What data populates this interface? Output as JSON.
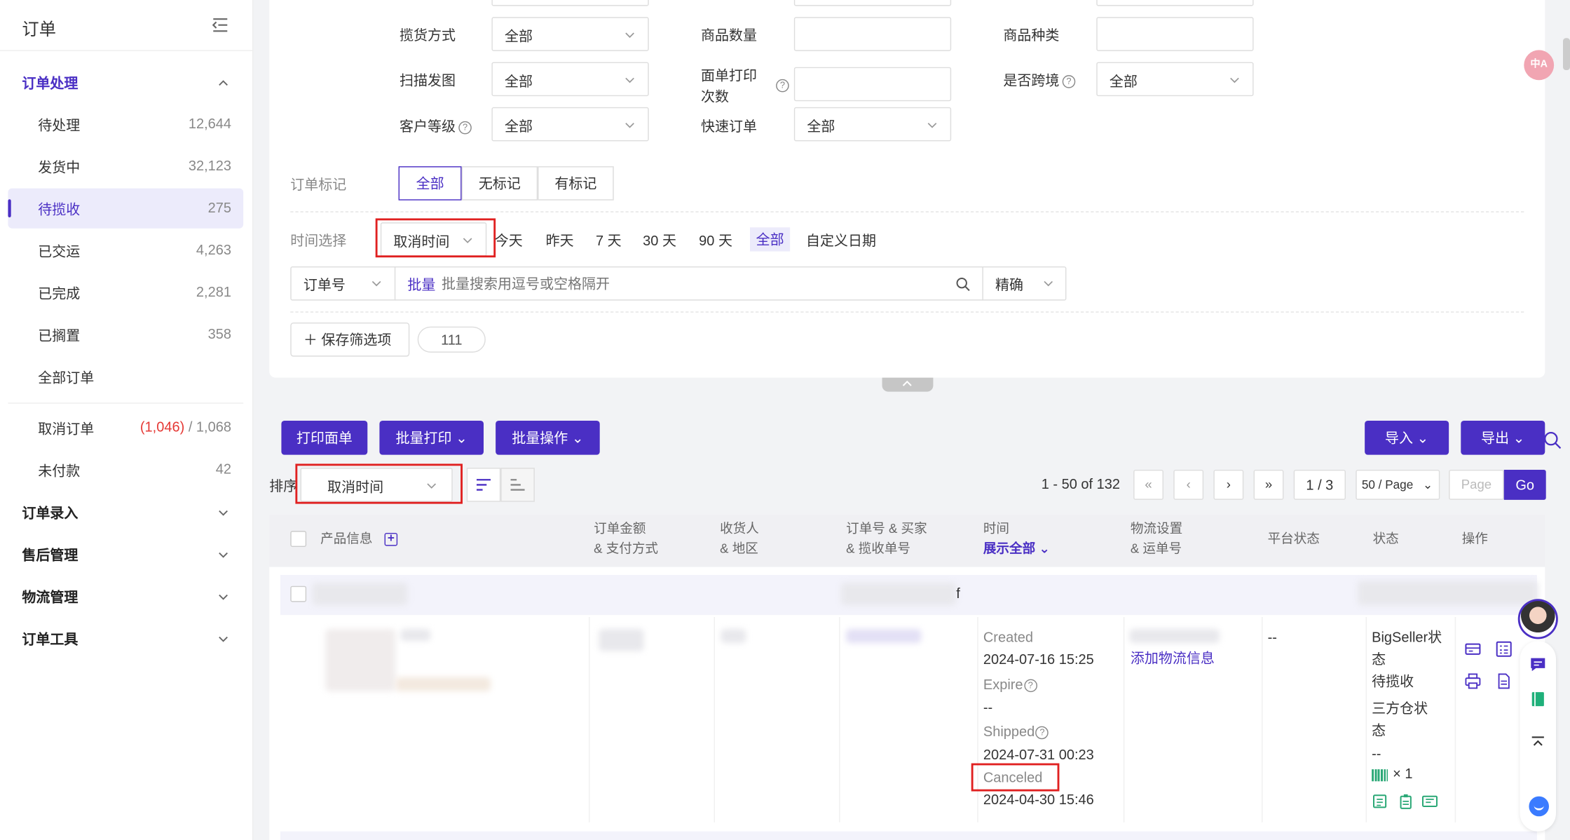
{
  "sidebar": {
    "title": "订单",
    "groups": {
      "processing": "订单处理",
      "entry": "订单录入",
      "aftersale": "售后管理",
      "logistics": "物流管理",
      "tools": "订单工具"
    },
    "items": [
      {
        "label": "待处理",
        "count": "12,644"
      },
      {
        "label": "发货中",
        "count": "32,123"
      },
      {
        "label": "待揽收",
        "count": "275"
      },
      {
        "label": "已交运",
        "count": "4,263"
      },
      {
        "label": "已完成",
        "count": "2,281"
      },
      {
        "label": "已搁置",
        "count": "358"
      },
      {
        "label": "全部订单",
        "count": ""
      }
    ],
    "cancel": {
      "label": "取消订单",
      "count_red": "(1,046)",
      "count_total": "/ 1,068"
    },
    "unpaid": {
      "label": "未付款",
      "count": "42"
    }
  },
  "filters": {
    "pickup_method": {
      "label": "揽货方式",
      "value": "全部"
    },
    "item_qty": {
      "label": "商品数量",
      "value": ""
    },
    "item_kinds": {
      "label": "商品种类",
      "value": ""
    },
    "scan_image": {
      "label": "扫描发图",
      "value": "全部"
    },
    "print_count": {
      "label1": "面单打印",
      "label2": "次数",
      "value": ""
    },
    "cross_border": {
      "label": "是否跨境",
      "value": "全部"
    },
    "customer_level": {
      "label": "客户等级",
      "value": "全部"
    },
    "fast_order": {
      "label": "快速订单",
      "value": "全部"
    },
    "order_mark": {
      "label": "订单标记",
      "options": [
        "全部",
        "无标记",
        "有标记"
      ]
    },
    "time": {
      "label": "时间选择",
      "field": "取消时间",
      "chips": [
        "今天",
        "昨天",
        "7 天",
        "30 天",
        "90 天",
        "全部",
        "自定义日期"
      ]
    },
    "search": {
      "field": "订单号",
      "batch": "批量",
      "placeholder": "批量搜索用逗号或空格隔开",
      "mode": "精确"
    },
    "save_label": "保存筛选项",
    "saved_tag": "111"
  },
  "toolbar": {
    "print_label": "打印面单",
    "batch_print": "批量打印",
    "batch_ops": "批量操作",
    "import": "导入",
    "export": "导出",
    "sort_label": "排序",
    "sort_field": "取消时间",
    "range": "1 - 50 of 132",
    "page": "1 / 3",
    "per_page": "50 / Page",
    "page_placeholder": "Page",
    "go": "Go"
  },
  "table": {
    "headers": {
      "product": "产品信息",
      "amount1": "订单金额",
      "amount2": "& 支付方式",
      "recv1": "收货人",
      "recv2": "& 地区",
      "orderno1": "订单号 & 买家",
      "orderno2": "& 揽收单号",
      "time": "时间",
      "time_expand": "展示全部",
      "logi1": "物流设置",
      "logi2": "& 运单号",
      "platform": "平台状态",
      "status": "状态",
      "ops": "操作"
    },
    "row": {
      "created_label": "Created",
      "created": "2024-07-16 15:25",
      "expire_label": "Expire",
      "expire": "--",
      "shipped_label": "Shipped",
      "shipped": "2024-07-31 00:23",
      "canceled_label": "Canceled",
      "canceled": "2024-04-30 15:46",
      "add_logistics": "添加物流信息",
      "platform_status": "--",
      "status1": "BigSeller状",
      "status2": "态",
      "status3": "待揽收",
      "status4": "三方仓状",
      "status5": "态",
      "status6": "--",
      "qty": "× 1",
      "header_f": "f"
    }
  },
  "colors": {
    "accent": "#4a2fc4",
    "highlight": "#e02020"
  }
}
